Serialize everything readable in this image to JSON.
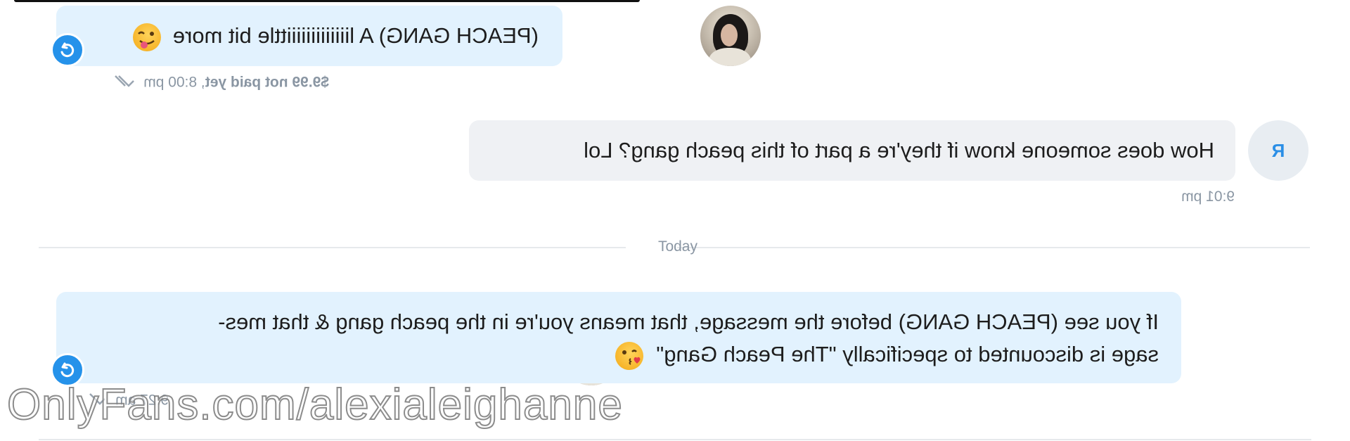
{
  "messages": [
    {
      "text": "(PEACH GANG) A liiiiiiiiiiiiittle bit more",
      "emoji": "winking-tongue-emoji",
      "price_status": "$9.99 not paid yet",
      "time": "8:00 pm"
    },
    {
      "avatar_letter": "R",
      "text": "How does someone know if they're a part of this peach gang? Lol",
      "time": "9:01 pm"
    },
    {
      "line1": "If you see (PEACH GANG) before the message, that means you're in the peach gang & that mes-",
      "line2": "sage is discounted to specifically \"The Peach Gang\"",
      "emoji": "kissing-heart-emoji",
      "time": "9:27 am"
    }
  ],
  "divider": {
    "label": "Today"
  },
  "watermark": "OnlyFans.com/alexialeighanne",
  "colors": {
    "incoming_bubble": "#e2f2fe",
    "outgoing_bubble": "#eff1f4",
    "accent": "#2592ea",
    "meta": "#8a96a3"
  }
}
